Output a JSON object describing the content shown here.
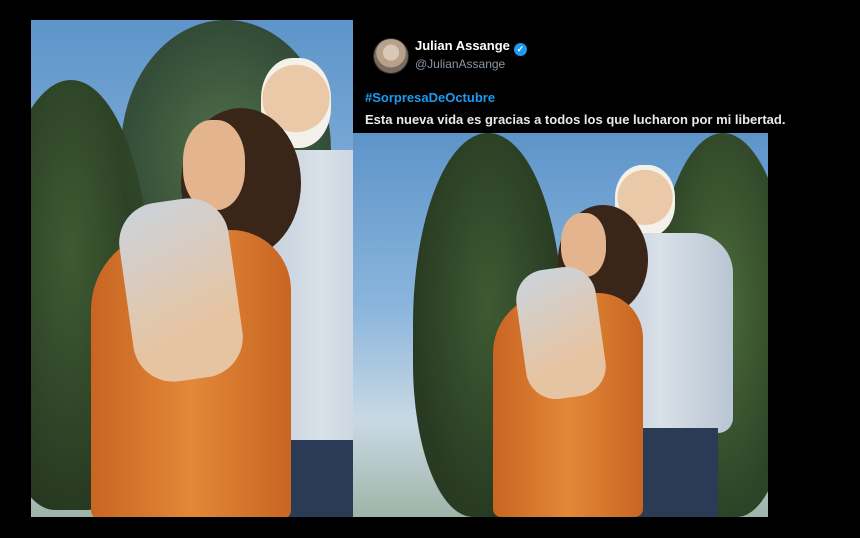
{
  "tweet": {
    "author_name": "Julian Assange",
    "author_handle": "@JulianAssange",
    "hashtag": "#SorpresaDeOctubre",
    "text": "Esta nueva vida es gracias a todos los que lucharon por mi libertad.",
    "verified_icon": "verified-badge-icon"
  },
  "colors": {
    "background": "#000000",
    "hashtag": "#1d9bf0",
    "handle": "#8b98a5",
    "text": "#e7e9ea",
    "dress": "#d9772b",
    "shirt": "#c9d3de",
    "jeans": "#2b3a55",
    "sky": "#7faad6"
  }
}
